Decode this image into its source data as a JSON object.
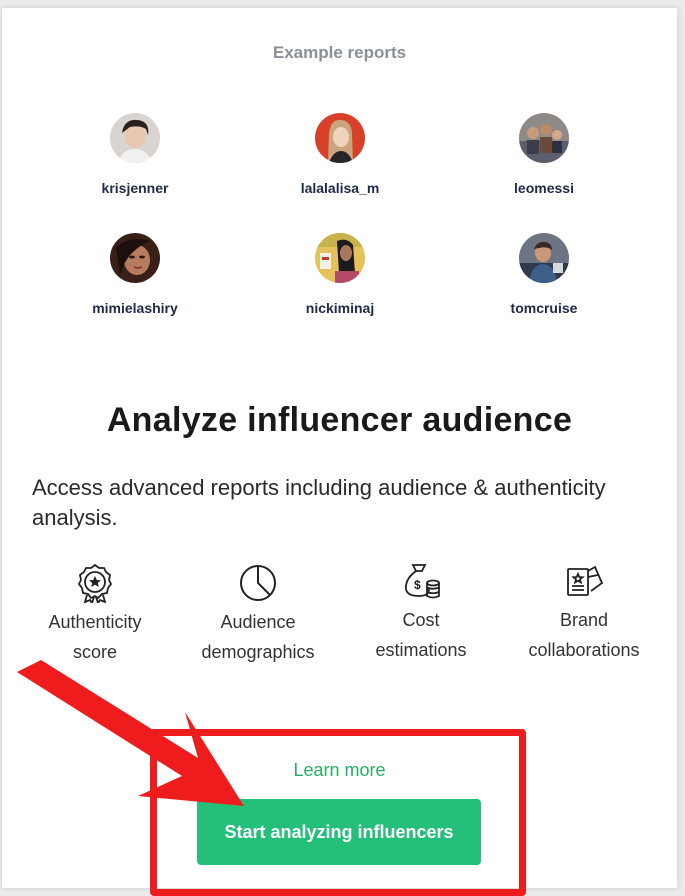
{
  "section_title": "Example reports",
  "profiles": [
    {
      "username": "krisjenner",
      "icon": "avatar-photo"
    },
    {
      "username": "lalalalisa_m",
      "icon": "avatar-photo"
    },
    {
      "username": "leomessi",
      "icon": "avatar-photo"
    },
    {
      "username": "mimielashiry",
      "icon": "avatar-photo"
    },
    {
      "username": "nickiminaj",
      "icon": "avatar-photo"
    },
    {
      "username": "tomcruise",
      "icon": "avatar-photo"
    }
  ],
  "headline": "Analyze influencer audience",
  "description": "Access advanced reports including audience & authenticity analysis.",
  "features": [
    {
      "line1": "Authenticity",
      "line2": "score",
      "icon": "badge-star-icon"
    },
    {
      "line1": "Audience",
      "line2": "demographics",
      "icon": "pie-chart-icon"
    },
    {
      "line1": "Cost",
      "line2": "estimations",
      "icon": "money-bag-icon"
    },
    {
      "line1": "Brand",
      "line2": "collaborations",
      "icon": "certificate-cards-icon"
    }
  ],
  "learn_more": "Learn more",
  "cta_label": "Start analyzing influencers",
  "colors": {
    "accent_green": "#24c07a",
    "link_green": "#27ae60",
    "annotation_red": "#ee1c1c",
    "heading_navy": "#1e2a4a"
  }
}
